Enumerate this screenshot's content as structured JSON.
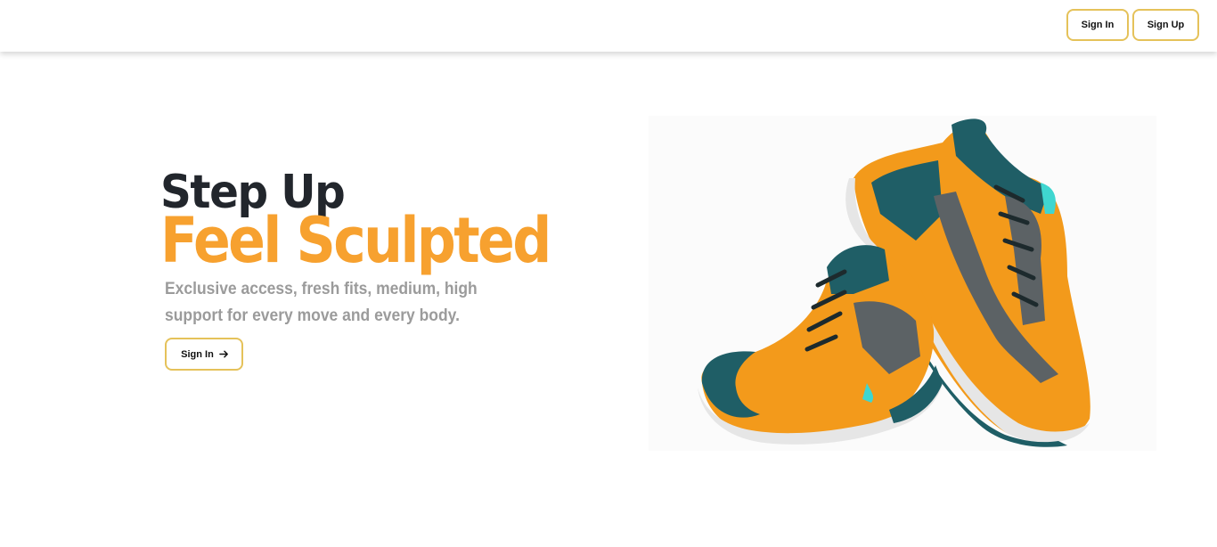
{
  "header": {
    "sign_in_label": "Sign In",
    "sign_up_label": "Sign Up"
  },
  "hero": {
    "title_line1": "Step Up",
    "title_line2": "Feel Sculpted",
    "subtitle": "Exclusive access, fresh fits, medium, high support for every move and every body.",
    "cta_label": "Sign In",
    "cta_icon": "arrow-right-icon",
    "image": "sneakers-pair"
  },
  "colors": {
    "accent": "#f7a12f",
    "button_border": "#e5c25a",
    "heading": "#22262c",
    "subtitle": "#9b9b9b",
    "shoe_teal": "#1f5e66",
    "shoe_orange": "#f39a1b",
    "shoe_grey": "#5c6265"
  }
}
